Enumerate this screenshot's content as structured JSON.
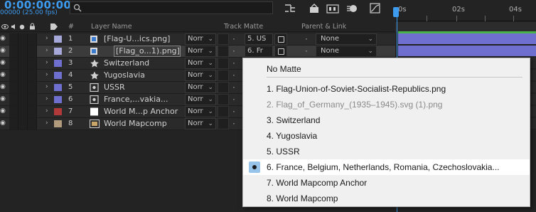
{
  "timecode": "0:00:00:00",
  "fps": "00000 (25.00 fps)",
  "search": {
    "placeholder": ""
  },
  "headers": {
    "layer_name": "Layer Name",
    "track_matte": "Track Matte",
    "parent_link": "Parent & Link",
    "num": "#"
  },
  "ruler": {
    "t0": "0s",
    "t1": "02s",
    "t2": "04s"
  },
  "layers": [
    {
      "num": "1",
      "name": "[Flag-U...ics.png]",
      "mode": "Norr",
      "matte": "5. US",
      "parent": "None",
      "label_color": "#a5a8d8",
      "type": "footage",
      "selected": false,
      "boxed": false
    },
    {
      "num": "2",
      "name": "[Flag_o...1).png]",
      "mode": "Norr",
      "matte": "6. Fr",
      "parent": "None",
      "label_color": "#a5a8d8",
      "type": "footage",
      "selected": true,
      "boxed": true
    },
    {
      "num": "3",
      "name": "Switzerland",
      "mode": "Norr",
      "matte": "",
      "parent": "",
      "label_color": "#6f6fd0",
      "type": "shape",
      "selected": false,
      "boxed": false
    },
    {
      "num": "4",
      "name": "Yugoslavia",
      "mode": "Norr",
      "matte": "",
      "parent": "",
      "label_color": "#6f6fd0",
      "type": "shape",
      "selected": false,
      "boxed": false
    },
    {
      "num": "5",
      "name": "USSR",
      "mode": "Norr",
      "matte": "",
      "parent": "",
      "label_color": "#6f6fd0",
      "type": "comp",
      "selected": false,
      "boxed": false
    },
    {
      "num": "6",
      "name": "France,...vakia...",
      "mode": "Norr",
      "matte": "",
      "parent": "",
      "label_color": "#6f6fd0",
      "type": "comp",
      "selected": false,
      "boxed": false
    },
    {
      "num": "7",
      "name": "World M...p Anchor",
      "mode": "Norr",
      "matte": "",
      "parent": "",
      "label_color": "#b03a3a",
      "type": "solid",
      "selected": false,
      "boxed": false
    },
    {
      "num": "8",
      "name": "World Mapcomp",
      "mode": "Norr",
      "matte": "",
      "parent": "",
      "label_color": "#b29a7c",
      "type": "precomp",
      "selected": false,
      "boxed": false
    }
  ],
  "menu": {
    "items": [
      {
        "label": "No Matte",
        "disabled": false,
        "checked": false
      },
      {
        "label": "1. Flag-Union-of-Soviet-Socialist-Republics.png",
        "disabled": false,
        "checked": false
      },
      {
        "label": "2. Flag_of_Germany_(1935–1945).svg (1).png",
        "disabled": true,
        "checked": false
      },
      {
        "label": "3. Switzerland",
        "disabled": false,
        "checked": false
      },
      {
        "label": "4. Yugoslavia",
        "disabled": false,
        "checked": false
      },
      {
        "label": "5. USSR",
        "disabled": false,
        "checked": false
      },
      {
        "label": "6. France, Belgium, Netherlands, Romania, Czechoslovakia...",
        "disabled": false,
        "checked": true
      },
      {
        "label": "7. World Mapcomp Anchor",
        "disabled": false,
        "checked": false
      },
      {
        "label": "8. World Mapcomp",
        "disabled": false,
        "checked": false
      }
    ]
  },
  "colors": {
    "accent": "#3d9bf0",
    "work_area": "#49b34a",
    "layer_bar": "#6f6fd0"
  },
  "icons": [
    "search-icon",
    "eye-icon",
    "audio-icon",
    "solo-icon",
    "lock-icon",
    "label-icon",
    "shy-icon",
    "frame-blend-icon",
    "motion-blur-icon",
    "graph-editor-icon"
  ]
}
